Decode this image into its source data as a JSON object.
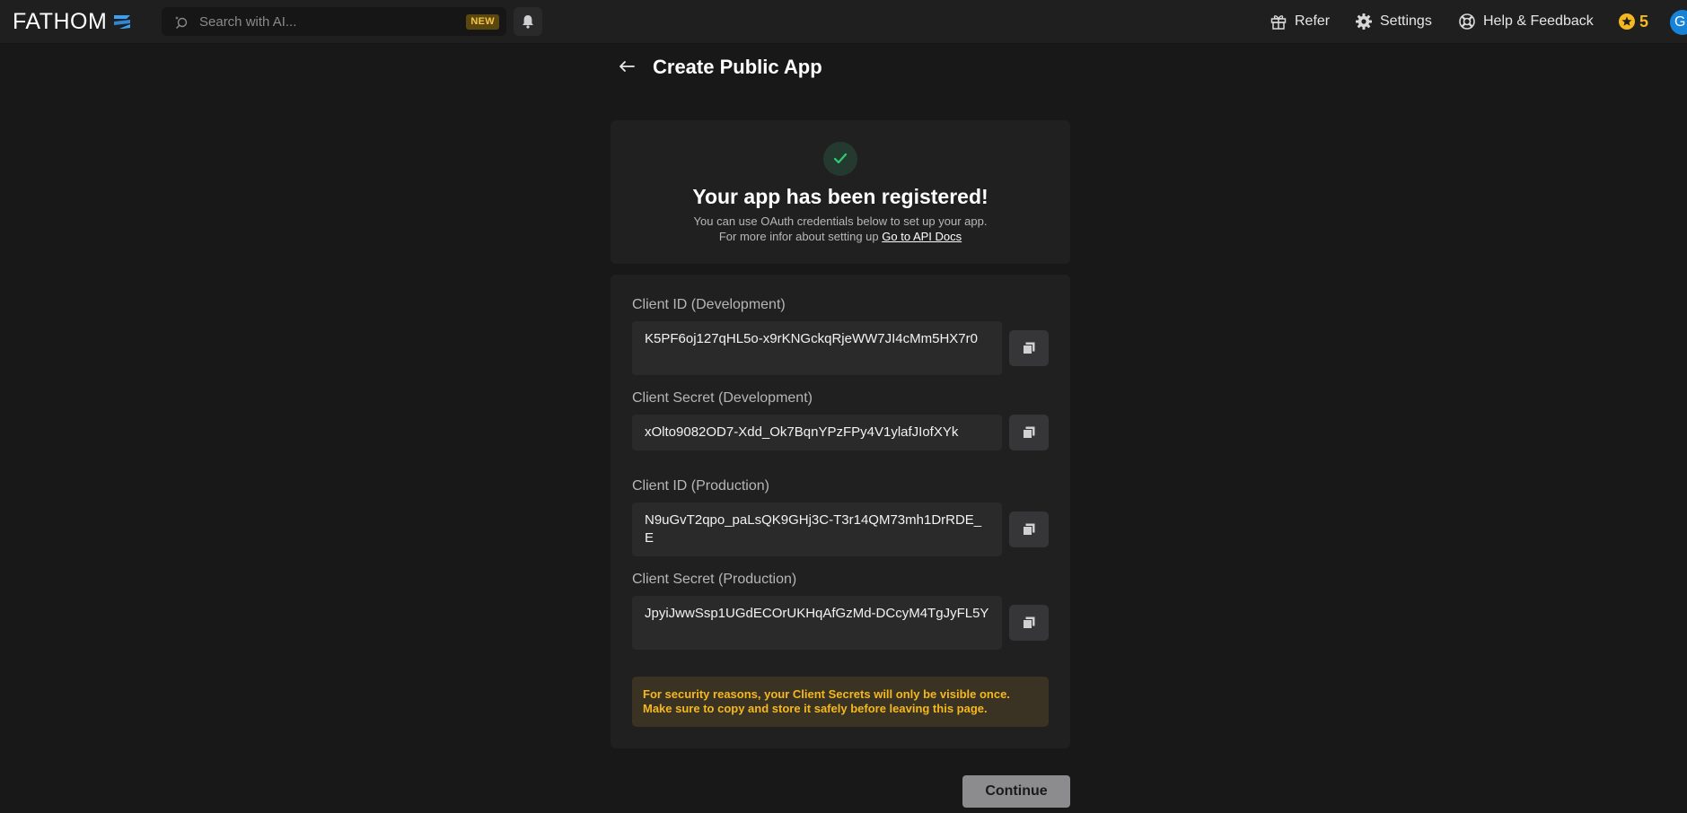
{
  "header": {
    "logo_text": "FATHOM",
    "search_placeholder": "Search with AI...",
    "search_badge": "NEW",
    "refer_label": "Refer",
    "settings_label": "Settings",
    "help_label": "Help & Feedback",
    "stars_count": "5",
    "avatar_initial": "G"
  },
  "page": {
    "title": "Create Public App"
  },
  "success": {
    "title": "Your app has been registered!",
    "line1": "You can use OAuth credentials below to set up your app.",
    "line2_prefix": "For more infor about setting up",
    "docs_link": "Go to API Docs",
    "accent_color": "#2ecc71"
  },
  "credentials": [
    {
      "label": "Client ID (Development)",
      "value": "K5PF6oj127qHL5o-x9rKNGckqRjeWW7JI4cMm5HX7r0"
    },
    {
      "label": "Client Secret (Development)",
      "value": "xOlto9082OD7-Xdd_Ok7BqnYPzFPy4V1ylafJIofXYk"
    },
    {
      "label": "Client ID (Production)",
      "value": "N9uGvT2qpo_paLsQK9GHj3C-T3r14QM73mh1DrRDE_E"
    },
    {
      "label": "Client Secret (Production)",
      "value": "JpyiJwwSsp1UGdECOrUKHqAfGzMd-DCcyM4TgJyFL5Y"
    }
  ],
  "warning": {
    "line1": "For security reasons, your Client Secrets will only be visible once.",
    "line2": "Make sure to copy and store it safely before leaving this page.",
    "color": "#f5b81e"
  },
  "actions": {
    "continue_label": "Continue"
  }
}
